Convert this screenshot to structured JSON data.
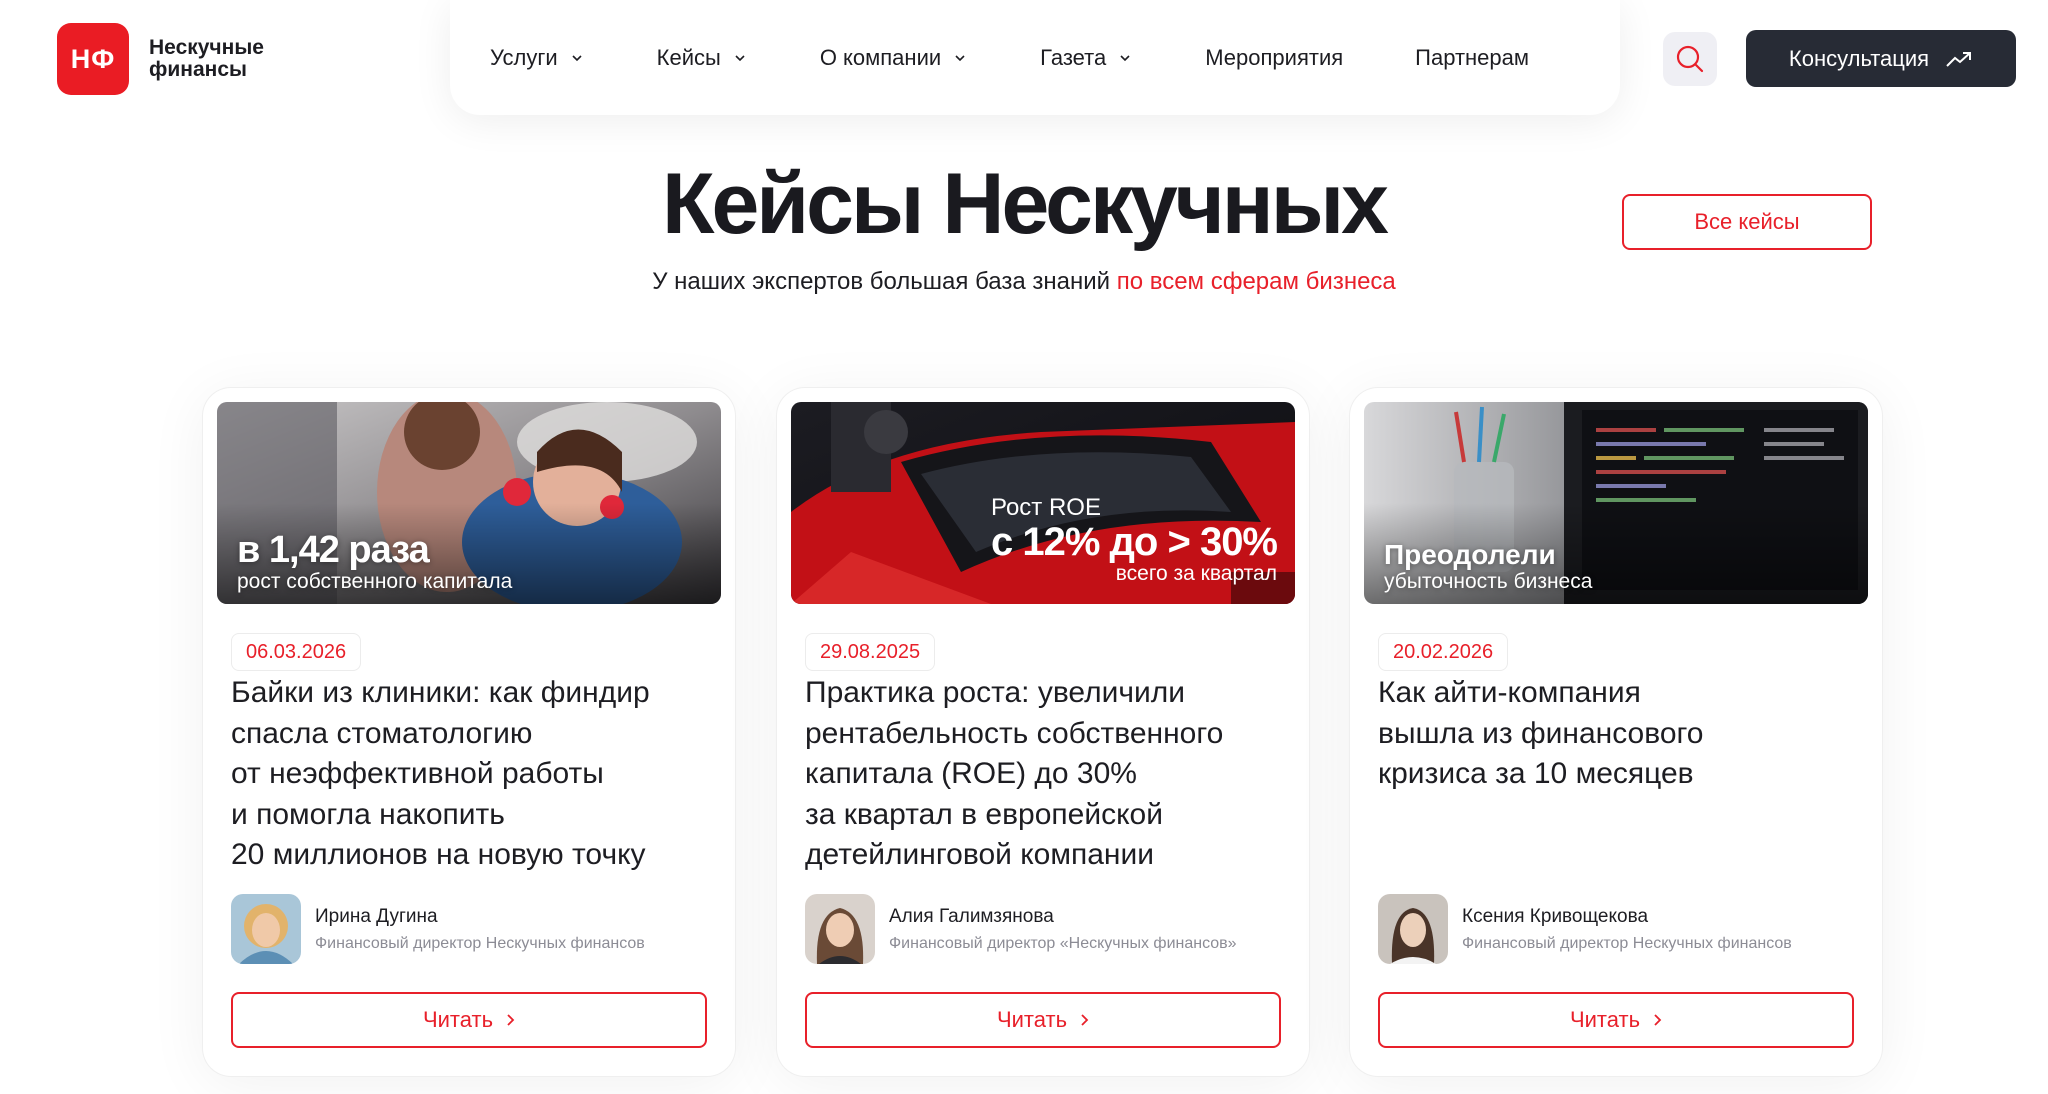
{
  "header": {
    "logo_mark": "НФ",
    "logo_text": "Нескучные\nфинансы",
    "nav": [
      {
        "label": "Услуги",
        "dropdown": true
      },
      {
        "label": "Кейсы",
        "dropdown": true
      },
      {
        "label": "О компании",
        "dropdown": true
      },
      {
        "label": "Газета",
        "dropdown": true
      },
      {
        "label": "Мероприятия",
        "dropdown": false
      },
      {
        "label": "Партнерам",
        "dropdown": false
      }
    ],
    "search_icon": "search-icon",
    "consult_label": "Консультация",
    "consult_icon": "trend-up-icon"
  },
  "section": {
    "title": "Кейсы Нескучных",
    "subtitle_plain": "У наших экспертов большая база знаний ",
    "subtitle_accent": "по всем сферам бизнеса",
    "all_cases_label": "Все кейсы"
  },
  "cards": [
    {
      "image_caption_big": "в 1,42 раза",
      "image_caption_small": "рост собственного капитала",
      "date": "06.03.2026",
      "title": "Байки из клиники: как финдир\nспасла стоматологию\nот неэффективной работы\nи помогла накопить\n20 миллионов на новую точку",
      "author_name": "Ирина Дугина",
      "author_role": "Финансовый директор Нескучных финансов",
      "read_label": "Читать"
    },
    {
      "image_caption_line1": "Рост ROE",
      "image_caption_line2": "с 12% до > 30%",
      "image_caption_line3": "всего за квартал",
      "date": "29.08.2025",
      "title": "Практика роста: увеличили\nрентабельность собственного\nкапитала (ROE) до 30%\nза квартал в европейской\nдетейлинговой компании",
      "author_name": "Алия Галимзянова",
      "author_role": "Финансовый директор «Нескучных финансов»",
      "read_label": "Читать"
    },
    {
      "image_caption_big": "Преодолели",
      "image_caption_small": "убыточность бизнеса",
      "date": "20.02.2026",
      "title": "Как айти-компания\nвышла из финансового\nкризиса за 10 месяцев",
      "author_name": "Ксения Кривощекова",
      "author_role": "Финансовый директор Нескучных финансов",
      "read_label": "Читать"
    }
  ],
  "colors": {
    "accent": "#e8202a",
    "dark_button": "#272b35",
    "logo_red": "#ea1c24"
  }
}
